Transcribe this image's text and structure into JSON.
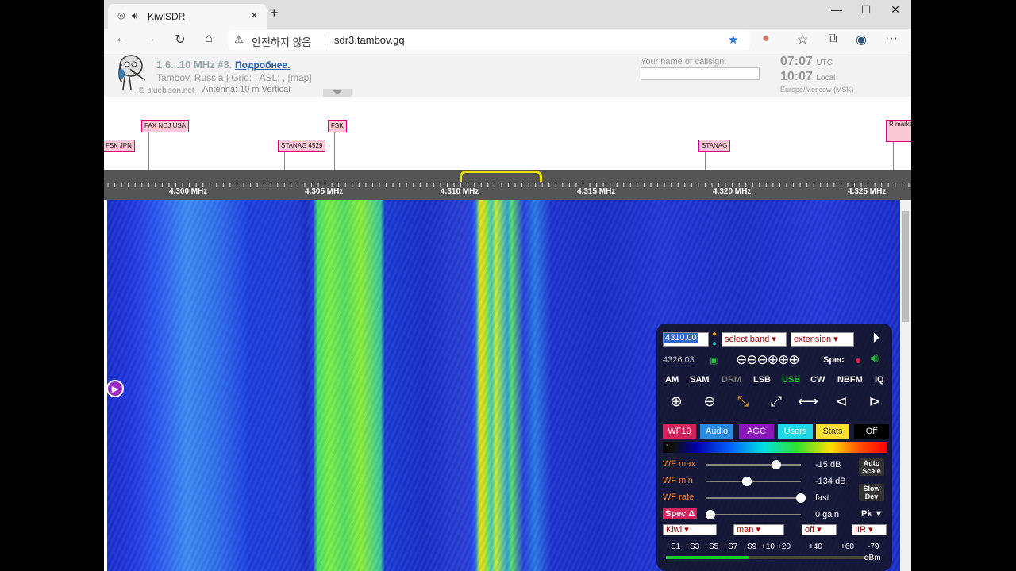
{
  "browser": {
    "tab_title": "KiwiSDR",
    "tab_close": "×",
    "new_tab": "+",
    "insecure_label": "안전하지 않음",
    "url": "sdr3.tambov.gq",
    "icons": [
      "back-icon",
      "forward-icon",
      "refresh-icon",
      "home-icon",
      "star-icon",
      "extension-icon",
      "favorites-icon",
      "collections-icon",
      "profile-icon",
      "more-icon"
    ]
  },
  "header": {
    "title": "1.6...10 MHz #3.",
    "more_link": "Подробнее.",
    "location": "Tambov, Russia | Grid: , ASL: ,",
    "map_link": "[map]",
    "owner": "© bluebison.net",
    "antenna": "Antenna: 10 m Vertical",
    "callsign_label": "Your name or callsign:",
    "callsign_value": "",
    "utc_time": "07:07",
    "utc_label": "UTC",
    "local_time": "10:07",
    "local_label": "Local",
    "timezone": "Europe/Moscow (MSK)"
  },
  "labels": [
    {
      "text": "FSK JPN"
    },
    {
      "text": "FAX NOJ USA"
    },
    {
      "text": "STANAG 4529"
    },
    {
      "text": "FSK"
    },
    {
      "text": "STANAG"
    },
    {
      "text": "R marke"
    }
  ],
  "scale": {
    "ticks": [
      "4.300 MHz",
      "4.305 MHz",
      "4.310 MHz",
      "4.315 MHz",
      "4.320 MHz",
      "4.325 MHz"
    ]
  },
  "panel": {
    "frequency": "4310.00",
    "band_select": "select band",
    "extension_select": "extension",
    "freq_readout": "4326.03",
    "spec_label": "Spec",
    "modes": [
      "AM",
      "SAM",
      "DRM",
      "LSB",
      "USB",
      "CW",
      "NBFM",
      "IQ"
    ],
    "active_mode": "USB",
    "tabs": [
      {
        "label": "WF10",
        "color": "#d4225a"
      },
      {
        "label": "Audio",
        "color": "#2a8ae0"
      },
      {
        "label": "AGC",
        "color": "#8a18b8"
      },
      {
        "label": "Users",
        "color": "#1ed8e8"
      },
      {
        "label": "Stats",
        "color": "#f8e030"
      },
      {
        "label": "Off",
        "color": "#000000"
      }
    ],
    "colormap_marker": "-",
    "sliders": [
      {
        "label": "WF max",
        "value": "-15 dB",
        "level": 0.73
      },
      {
        "label": "WF min",
        "value": "-134 dB",
        "level": 0.4
      },
      {
        "label": "WF rate",
        "value": "fast",
        "level": 1.0
      }
    ],
    "spec_delta_label": "Spec Δ",
    "spec_delta_value": "0 gain",
    "auto_scale": "Auto Scale",
    "slow_dev": "Slow Dev",
    "pk_label": "Pk ▼",
    "dropdowns": [
      "Kiwi",
      "man",
      "off",
      "IIR"
    ],
    "smeter_scale": [
      "S1",
      "S3",
      "S5",
      "S7",
      "S9",
      "+10",
      "+20",
      "+40",
      "+60",
      "-79"
    ],
    "smeter_unit": "dBm",
    "smeter_level": 0.4
  }
}
